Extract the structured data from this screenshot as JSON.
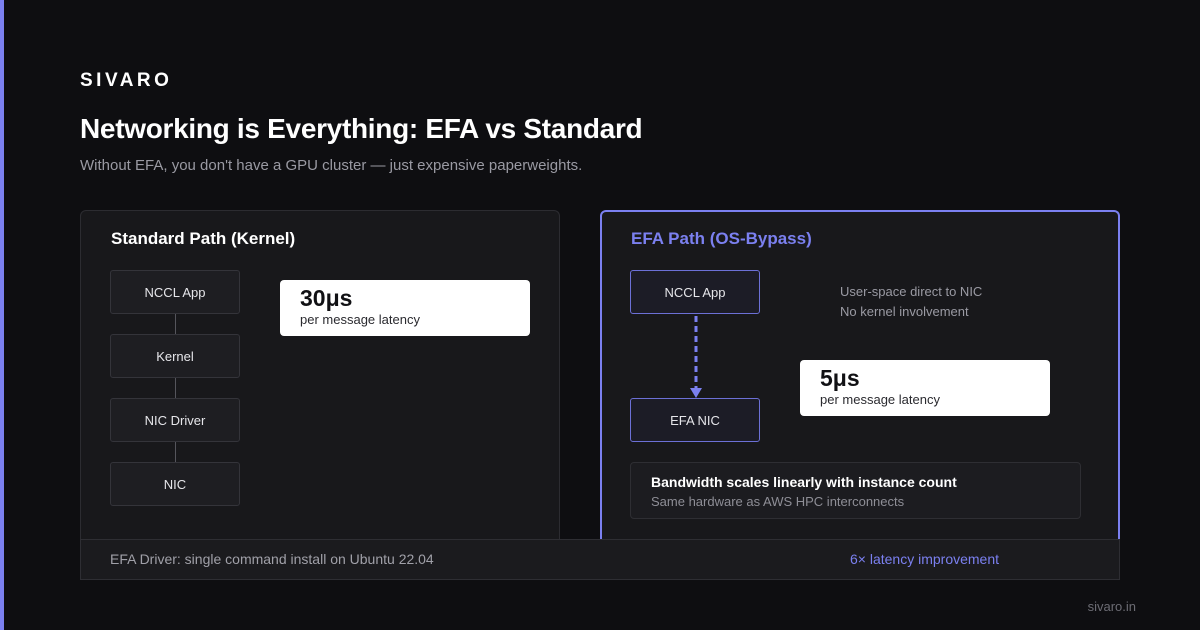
{
  "brand": "SIVARO",
  "title": "Networking is Everything: EFA vs Standard",
  "subtitle": "Without EFA, you don't have a GPU cluster — just expensive paperweights.",
  "standard": {
    "title": "Standard Path (Kernel)",
    "nodes": [
      "NCCL App",
      "Kernel",
      "NIC Driver",
      "NIC"
    ],
    "metric": {
      "value": "30μs",
      "label": "per message latency"
    }
  },
  "efa": {
    "title": "EFA Path (OS-Bypass)",
    "nodes": [
      "NCCL App",
      "EFA NIC"
    ],
    "notes": [
      "User-space direct to NIC",
      "No kernel involvement"
    ],
    "metric": {
      "value": "5μs",
      "label": "per message latency"
    },
    "bandwidth": {
      "title": "Bandwidth scales linearly with instance count",
      "subtitle": "Same hardware as AWS HPC interconnects"
    }
  },
  "footer": {
    "left": "EFA Driver: single command install on Ubuntu 22.04",
    "right": "6× latency improvement"
  },
  "site": "sivaro.in",
  "colors": {
    "accent": "#7b80f0",
    "background": "#0e0e11",
    "panel": "#18181b"
  }
}
